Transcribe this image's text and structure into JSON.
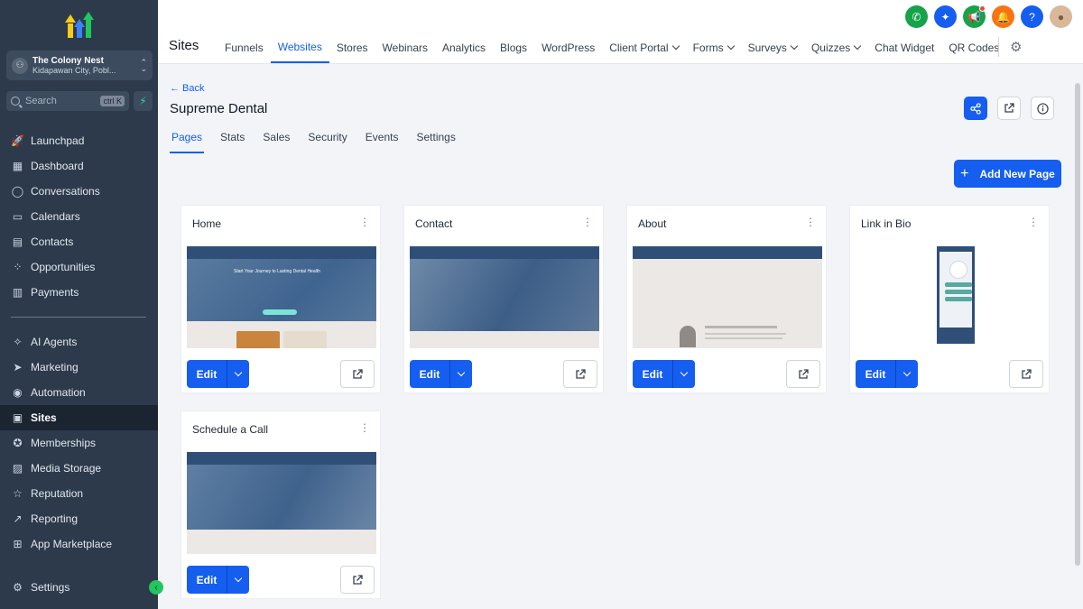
{
  "account": {
    "name": "The Colony Nest",
    "location": "Kidapawan City, Pobl..."
  },
  "search": {
    "placeholder": "Search",
    "shortcut": "ctrl K"
  },
  "sidebar": {
    "items": [
      {
        "label": "Launchpad",
        "icon": "rocket-icon"
      },
      {
        "label": "Dashboard",
        "icon": "grid-icon"
      },
      {
        "label": "Conversations",
        "icon": "chat-icon"
      },
      {
        "label": "Calendars",
        "icon": "calendar-icon"
      },
      {
        "label": "Contacts",
        "icon": "contacts-icon"
      },
      {
        "label": "Opportunities",
        "icon": "opportunities-icon"
      },
      {
        "label": "Payments",
        "icon": "payments-icon"
      }
    ],
    "items2": [
      {
        "label": "AI Agents",
        "icon": "sparkle-icon"
      },
      {
        "label": "Marketing",
        "icon": "send-icon"
      },
      {
        "label": "Automation",
        "icon": "automation-icon"
      },
      {
        "label": "Sites",
        "icon": "sites-icon",
        "active": true
      },
      {
        "label": "Memberships",
        "icon": "badge-icon"
      },
      {
        "label": "Media Storage",
        "icon": "image-icon"
      },
      {
        "label": "Reputation",
        "icon": "star-icon"
      },
      {
        "label": "Reporting",
        "icon": "trend-icon"
      },
      {
        "label": "App Marketplace",
        "icon": "apps-icon"
      }
    ],
    "settings": "Settings"
  },
  "header": {
    "section": "Sites",
    "tabs": [
      {
        "label": "Funnels",
        "dropdown": false
      },
      {
        "label": "Websites",
        "dropdown": false,
        "active": true
      },
      {
        "label": "Stores",
        "dropdown": false
      },
      {
        "label": "Webinars",
        "dropdown": false
      },
      {
        "label": "Analytics",
        "dropdown": false
      },
      {
        "label": "Blogs",
        "dropdown": false
      },
      {
        "label": "WordPress",
        "dropdown": false
      },
      {
        "label": "Client Portal",
        "dropdown": true
      },
      {
        "label": "Forms",
        "dropdown": true
      },
      {
        "label": "Surveys",
        "dropdown": true
      },
      {
        "label": "Quizzes",
        "dropdown": true
      },
      {
        "label": "Chat Widget",
        "dropdown": false
      },
      {
        "label": "QR Codes",
        "dropdown": false
      }
    ],
    "icon_colors": {
      "phone": "#16a34a",
      "magic": "#155eef",
      "announce": "#16a34a",
      "bell": "#f97316",
      "help": "#155eef"
    }
  },
  "site": {
    "back": "← Back",
    "title": "Supreme Dental",
    "tabs": [
      "Pages",
      "Stats",
      "Sales",
      "Security",
      "Events",
      "Settings"
    ],
    "add_page": "Add New Page"
  },
  "pages": [
    {
      "title": "Home",
      "hero_text": "Start Your Journey to Lasting Dental Health"
    },
    {
      "title": "Contact"
    },
    {
      "title": "About"
    },
    {
      "title": "Link in Bio"
    },
    {
      "title": "Schedule a Call"
    }
  ],
  "card_actions": {
    "edit": "Edit"
  },
  "colors": {
    "primary": "#155eef",
    "sidebar": "#2c3a4c",
    "sidebar_active": "#1b2532"
  }
}
